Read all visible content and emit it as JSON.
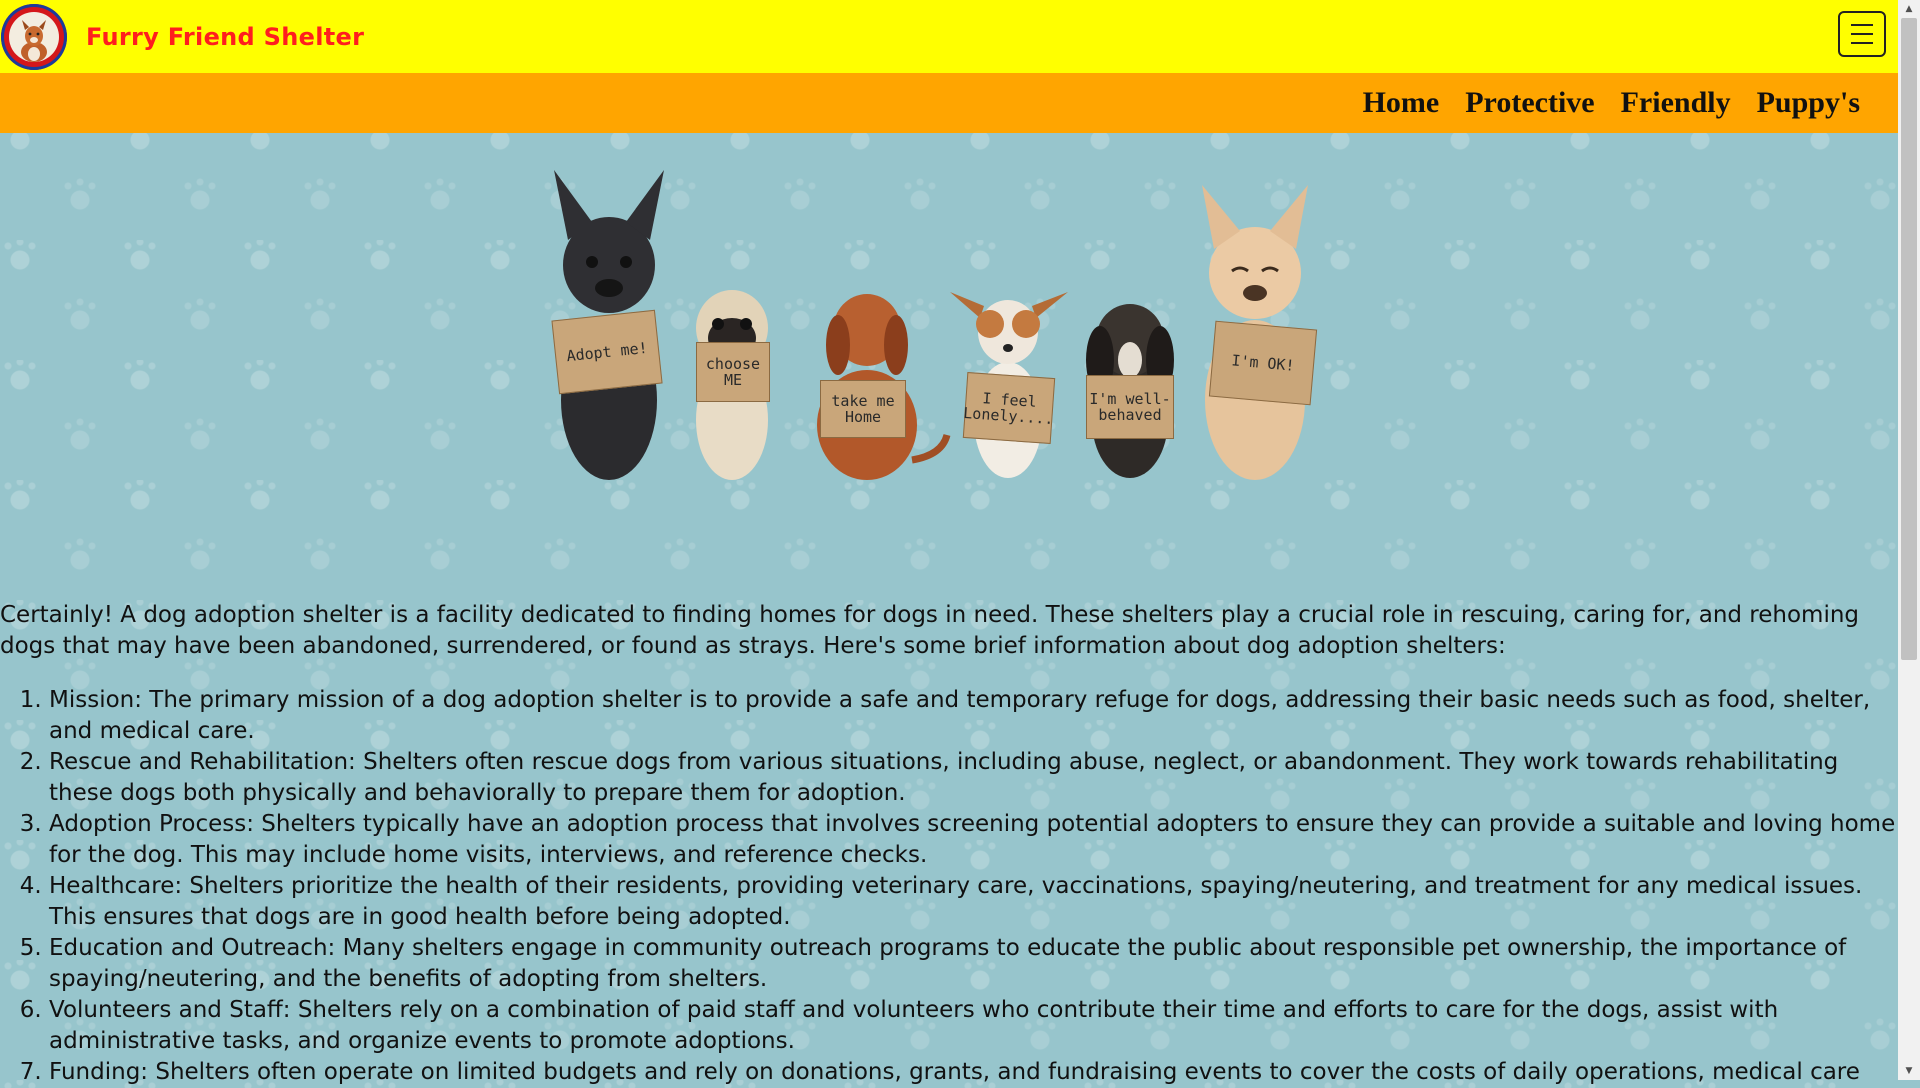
{
  "brand": {
    "name": "Furry Friend Shelter",
    "logo_icon": "dog-logo-icon"
  },
  "nav": {
    "menu_icon": "hamburger-menu-icon",
    "links": [
      "Home",
      "Protective",
      "Friendly",
      "Puppy's"
    ]
  },
  "hero": {
    "signs": [
      "Adopt me!",
      "choose ME",
      "take me Home",
      "I feel Lonely....",
      "I'm well-behaved",
      "I'm OK!"
    ]
  },
  "content": {
    "intro": "Certainly! A dog adoption shelter is a facility dedicated to finding homes for dogs in need. These shelters play a crucial role in rescuing, caring for, and rehoming dogs that may have been abandoned, surrendered, or found as strays. Here's some brief information about dog adoption shelters:",
    "items": [
      "Mission: The primary mission of a dog adoption shelter is to provide a safe and temporary refuge for dogs, addressing their basic needs such as food, shelter, and medical care.",
      "Rescue and Rehabilitation: Shelters often rescue dogs from various situations, including abuse, neglect, or abandonment. They work towards rehabilitating these dogs both physically and behaviorally to prepare them for adoption.",
      "Adoption Process: Shelters typically have an adoption process that involves screening potential adopters to ensure they can provide a suitable and loving home for the dog. This may include home visits, interviews, and reference checks.",
      "Healthcare: Shelters prioritize the health of their residents, providing veterinary care, vaccinations, spaying/neutering, and treatment for any medical issues. This ensures that dogs are in good health before being adopted.",
      "Education and Outreach: Many shelters engage in community outreach programs to educate the public about responsible pet ownership, the importance of spaying/neutering, and the benefits of adopting from shelters.",
      "Volunteers and Staff: Shelters rely on a combination of paid staff and volunteers who contribute their time and efforts to care for the dogs, assist with administrative tasks, and organize events to promote adoptions.",
      "Funding: Shelters often operate on limited budgets and rely on donations, grants, and fundraising events to cover the costs of daily operations, medical care"
    ]
  }
}
